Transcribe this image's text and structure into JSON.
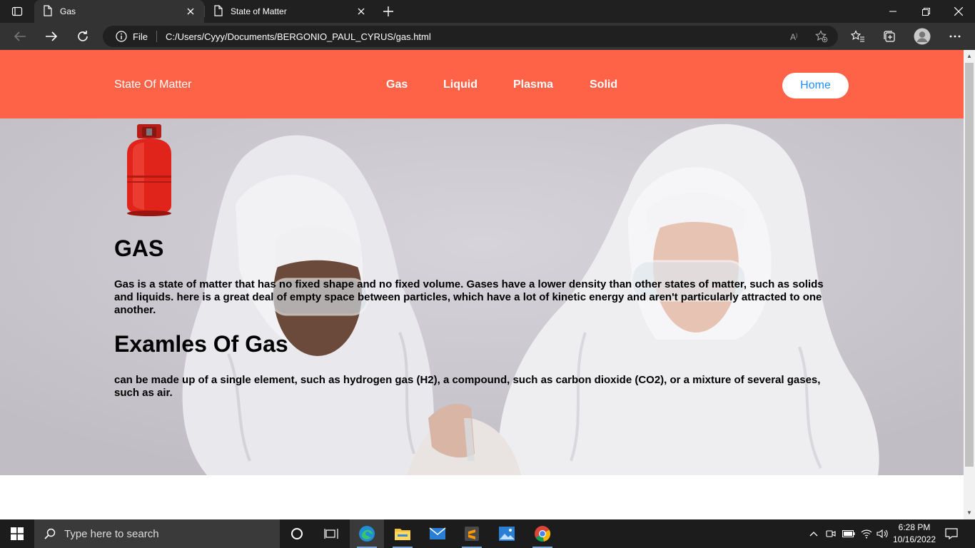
{
  "browser": {
    "tabs": [
      {
        "title": "Gas",
        "active": true
      },
      {
        "title": "State of Matter",
        "active": false
      }
    ],
    "address": {
      "scheme_label": "File",
      "url": "C:/Users/Cyyy/Documents/BERGONIO_PAUL_CYRUS/gas.html"
    }
  },
  "site": {
    "brand": "State Of Matter",
    "nav": [
      "Gas",
      "Liquid",
      "Plasma",
      "Solid"
    ],
    "home_button": "Home",
    "colors": {
      "nav_bg": "#ff6347",
      "home_text": "#1e90ff"
    }
  },
  "content": {
    "title": "GAS",
    "description": "Gas is a state of matter that has no fixed shape and no fixed volume. Gases have a lower density than other states of matter, such as solids and liquids. here is a great deal of empty space between particles, which have a lot of kinetic energy and aren't particularly attracted to one another.",
    "examples_title": "Examles Of Gas",
    "examples_description": "can be made up of a single element, such as hydrogen gas (H2), a compound, such as carbon dioxide (CO2), or a mixture of several gases, such as air."
  },
  "taskbar": {
    "search_placeholder": "Type here to search",
    "time": "6:28 PM",
    "date": "10/16/2022"
  }
}
